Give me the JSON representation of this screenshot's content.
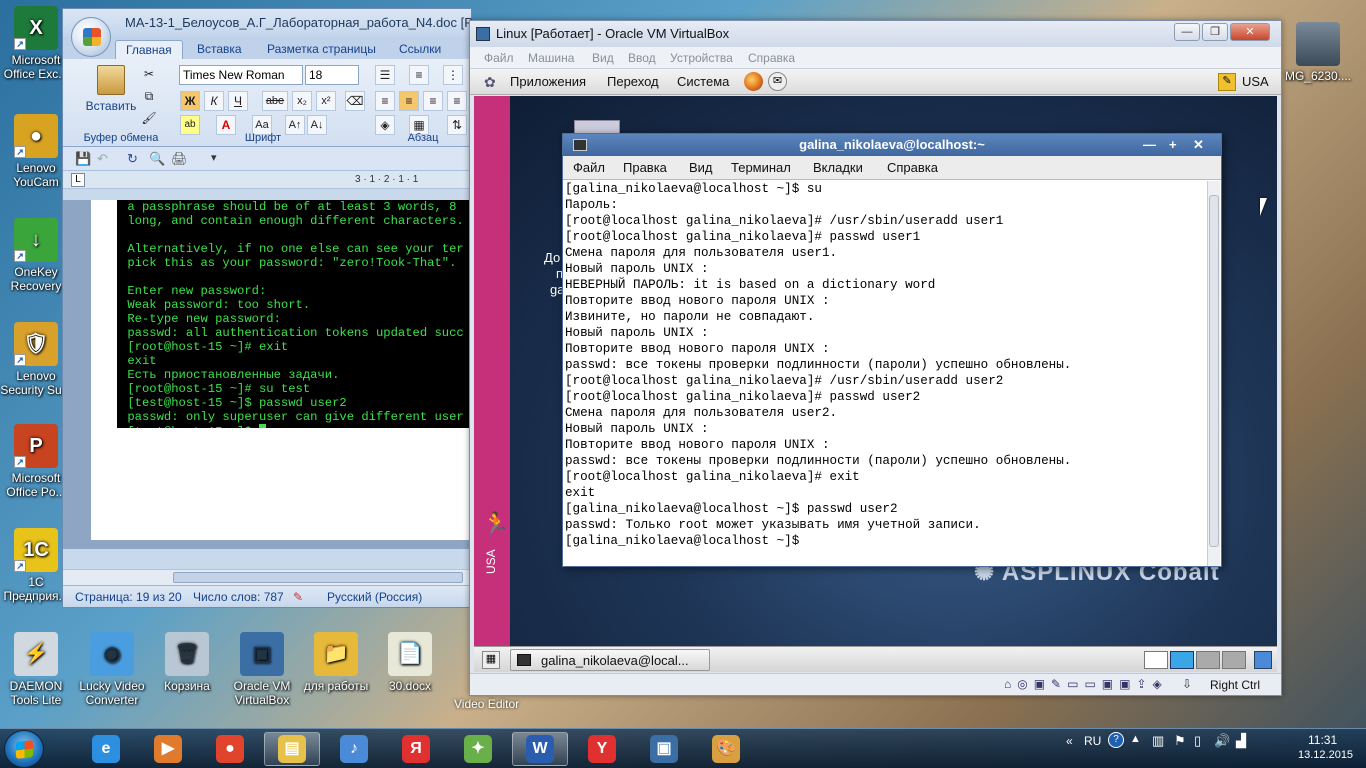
{
  "desktop": {
    "icons_left": [
      {
        "label": "Microsoft Office Exc...",
        "color": "#1d7a3a",
        "glyph": "X"
      },
      {
        "label": "Lenovo YouCam",
        "color": "#d8a320",
        "glyph": "●"
      },
      {
        "label": "OneKey Recovery",
        "color": "#3aa53a",
        "glyph": "↓"
      },
      {
        "label": "Lenovo Security Su...",
        "color": "#d7a12b",
        "glyph": "🛡"
      },
      {
        "label": "Microsoft Office Po...",
        "color": "#c8431f",
        "glyph": "P"
      },
      {
        "label": "1С Предприя...",
        "color": "#e8c31a",
        "glyph": "1С"
      }
    ],
    "icons_bottom": [
      {
        "label": "DAEMON Tools Lite",
        "color": "#d1d8e0",
        "glyph": "⚡"
      },
      {
        "label": "Lucky Video Converter",
        "color": "#4a9ee0",
        "glyph": "◉"
      },
      {
        "label": "Корзина",
        "color": "#b9c7d4",
        "glyph": "🗑"
      },
      {
        "label": "Oracle VM VirtualBox",
        "color": "#3b6ea5",
        "glyph": "▣"
      },
      {
        "label": "для работы",
        "color": "#e6b93a",
        "glyph": "📁"
      },
      {
        "label": "30.docx",
        "color": "#e8e8d8",
        "glyph": "📄"
      }
    ],
    "video_editor_label": "Video Editor",
    "right_icon_label": "MG_6230...."
  },
  "word": {
    "title": "МА-13-1_Белоусов_А.Г_Лабораторная_работа_N4.doc [Режим",
    "tabs": [
      "Главная",
      "Вставка",
      "Разметка страницы",
      "Ссылки"
    ],
    "active_tab": "Главная",
    "paste_label": "Вставить",
    "clipboard_group": "Буфер обмена",
    "font_group": "Шрифт",
    "paragraph_group": "Абзац",
    "font_name": "Times New Roman",
    "font_size": "18",
    "ruler_text": "3 · 1 · 2 · 1 · 1",
    "console_lines": [
      " a passphrase should be of at least 3 words, 8",
      " long, and contain enough different characters.",
      "",
      " Alternatively, if no one else can see your ter",
      " pick this as your password: \"zero!Took-That\".",
      "",
      " Enter new password:",
      " Weak password: too short.",
      " Re-type new password:",
      " passwd: all authentication tokens updated succ",
      " [root@host-15 ~]# exit",
      " exit",
      " Есть приостановленные задачи.",
      " [root@host-15 ~]# su test",
      " [test@host-15 ~]$ passwd user2",
      " passwd: only superuser can give different user",
      " [test@host-15 ~]$ "
    ],
    "status_page": "Страница: 19 из 20",
    "status_words": "Число слов: 787",
    "status_lang": "Русский (Россия)"
  },
  "vbox": {
    "title": "Linux [Работает] - Oracle VM VirtualBox",
    "menu": [
      "Файл",
      "Машина",
      "Вид",
      "Ввод",
      "Устройства",
      "Справка"
    ],
    "panel_menu": [
      "Приложения",
      "Переход",
      "Система"
    ],
    "keyboard_layout": "USA",
    "left_layout": "USA",
    "desktop_text": [
      "До",
      "п",
      "ga"
    ],
    "taskbar_item": "galina_nikolaeva@local...",
    "host_key": "Right Ctrl",
    "brand": "ASPLINUX Cobalt"
  },
  "terminal": {
    "title": "galina_nikolaeva@localhost:~",
    "menu": [
      "Файл",
      "Правка",
      "Вид",
      "Терминал",
      "Вкладки",
      "Справка"
    ],
    "lines": [
      "[galina_nikolaeva@localhost ~]$ su",
      "Пароль:",
      "[root@localhost galina_nikolaeva]# /usr/sbin/useradd user1",
      "[root@localhost galina_nikolaeva]# passwd user1",
      "Смена пароля для пользователя user1.",
      "Новый пароль UNIX :",
      "НЕВЕРНЫЙ ПАРОЛЬ: it is based on a dictionary word",
      "Повторите ввод нового пароля UNIX :",
      "Извините, но пароли не совпадают.",
      "Новый пароль UNIX :",
      "Повторите ввод нового пароля UNIX :",
      "passwd: все токены проверки подлинности (пароли) успешно обновлены.",
      "[root@localhost galina_nikolaeva]# /usr/sbin/useradd user2",
      "[root@localhost galina_nikolaeva]# passwd user2",
      "Смена пароля для пользователя user2.",
      "Новый пароль UNIX :",
      "Повторите ввод нового пароля UNIX :",
      "passwd: все токены проверки подлинности (пароли) успешно обновлены.",
      "[root@localhost galina_nikolaeva]# exit",
      "exit",
      "[galina_nikolaeva@localhost ~]$ passwd user2",
      "passwd: Только root может указывать имя учетной записи.",
      "[galina_nikolaeva@localhost ~]$"
    ]
  },
  "taskbar": {
    "lang": "RU",
    "time": "11:31",
    "date": "13.12.2015",
    "apps": [
      {
        "name": "ie",
        "glyph": "e",
        "color": "#2d8fe0"
      },
      {
        "name": "media",
        "glyph": "▶",
        "color": "#e07a2d"
      },
      {
        "name": "chrome",
        "glyph": "●",
        "color": "#e0442d"
      },
      {
        "name": "explorer",
        "glyph": "▤",
        "color": "#e6c24a"
      },
      {
        "name": "audio",
        "glyph": "♪",
        "color": "#4a8ad6"
      },
      {
        "name": "yandex",
        "glyph": "Я",
        "color": "#e03030"
      },
      {
        "name": "tools",
        "glyph": "✦",
        "color": "#6ab04a"
      },
      {
        "name": "word",
        "glyph": "W",
        "color": "#2a5db0"
      },
      {
        "name": "yandex-browser",
        "glyph": "Y",
        "color": "#e03030"
      },
      {
        "name": "virtualbox",
        "glyph": "▣",
        "color": "#3b6ea5"
      },
      {
        "name": "paint",
        "glyph": "🎨",
        "color": "#d8a040"
      }
    ]
  }
}
